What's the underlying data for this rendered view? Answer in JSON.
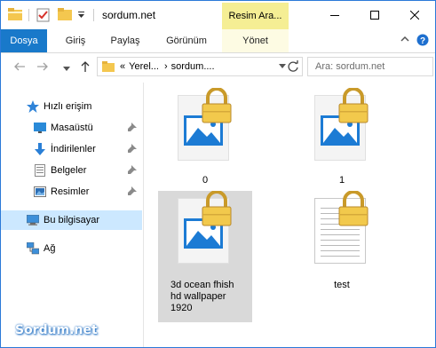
{
  "window": {
    "title": "sordum.net",
    "contextual_tab": "Resim Ara..."
  },
  "ribbon": {
    "tabs": [
      "Dosya",
      "Giriş",
      "Paylaş",
      "Görünüm",
      "Yönet"
    ]
  },
  "address": {
    "crumbs": [
      "Yerel...",
      "sordum...."
    ],
    "overflow": "«"
  },
  "search": {
    "placeholder": "Ara: sordum.net"
  },
  "nav": {
    "quick_access": "Hızlı erişim",
    "items": [
      "Masaüstü",
      "İndirilenler",
      "Belgeler",
      "Resimler"
    ],
    "this_pc": "Bu bilgisayar",
    "network": "Ağ"
  },
  "files": [
    {
      "name": "0",
      "kind": "image",
      "locked": true
    },
    {
      "name": "1",
      "kind": "image",
      "locked": true
    },
    {
      "name": "3d ocean fhish hd wallpaper 1920",
      "line1": "3d ocean fhish",
      "line2": "hd wallpaper",
      "line3": "1920",
      "kind": "image",
      "locked": true,
      "selected": true
    },
    {
      "name": "test",
      "kind": "text",
      "locked": true
    }
  ],
  "watermark": "Sordum.net",
  "colors": {
    "accent": "#1979ca",
    "context_tab": "#f5ee94",
    "selection": "#cce8ff"
  }
}
